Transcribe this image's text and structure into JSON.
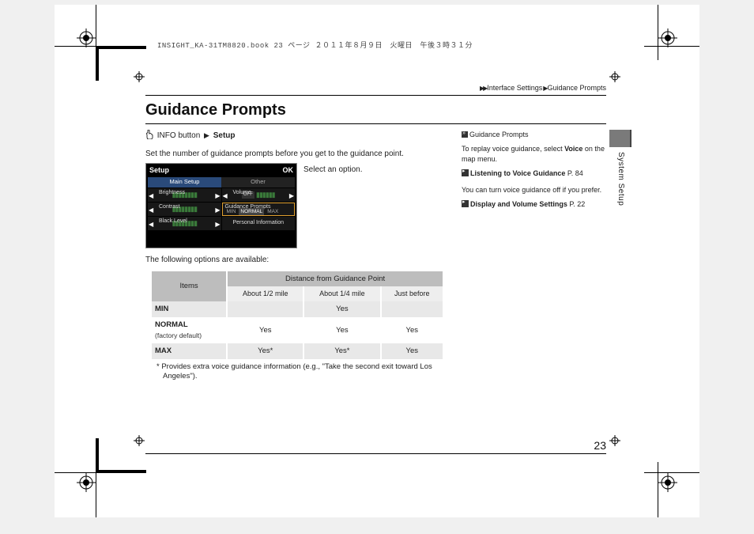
{
  "slug": "INSIGHT_KA-31TM8820.book  23 ページ  ２０１１年８月９日　火曜日　午後３時３１分",
  "breadcrumb": {
    "arrow": "▶▶",
    "p1": "Interface Settings",
    "p2": "Guidance Prompts"
  },
  "title": "Guidance Prompts",
  "navline": {
    "btn": "INFO button",
    "arrow": "▶",
    "target": "Setup"
  },
  "intro": "Set the number of guidance prompts before you get to the guidance point.",
  "select_caption": "Select an option.",
  "shot": {
    "title": "Setup",
    "ok": "OK",
    "tab1": "Main Setup",
    "tab2": "Other",
    "r1a": "Brightness",
    "r1b": "Volume",
    "r2a": "Contrast",
    "r2b": "Guidance Prompts",
    "r2b_opts": [
      "MIN",
      "NORMAL",
      "MAX"
    ],
    "r3a": "Black Level",
    "r3b": "Personal Information",
    "r1b_opts": [
      "OFF"
    ]
  },
  "options_intro": "The following options are available:",
  "table": {
    "h_items": "Items",
    "h_dist": "Distance from Guidance Point",
    "cols": [
      "About 1/2 mile",
      "About 1/4 mile",
      "Just before"
    ],
    "rows": [
      {
        "label": "MIN",
        "sub": "",
        "vals": [
          "",
          "Yes",
          ""
        ]
      },
      {
        "label": "NORMAL",
        "sub": "(factory default)",
        "vals": [
          "Yes",
          "Yes",
          "Yes"
        ]
      },
      {
        "label": "MAX",
        "sub": "",
        "vals": [
          "Yes*",
          "Yes*",
          "Yes"
        ]
      }
    ]
  },
  "footnote": "*  Provides extra voice guidance information (e.g., \"Take the second exit toward Los Angeles\").",
  "sidebar": {
    "hdr": "Guidance Prompts",
    "p1a": "To replay voice guidance, select ",
    "p1b": "Voice",
    "p1c": " on the map menu.",
    "link1": "Listening to Voice Guidance",
    "link1_page": " P. 84",
    "p2": "You can turn voice guidance off if you prefer.",
    "link2": "Display and Volume Settings",
    "link2_page": " P. 22"
  },
  "section_label": "System Setup",
  "page_number": "23"
}
